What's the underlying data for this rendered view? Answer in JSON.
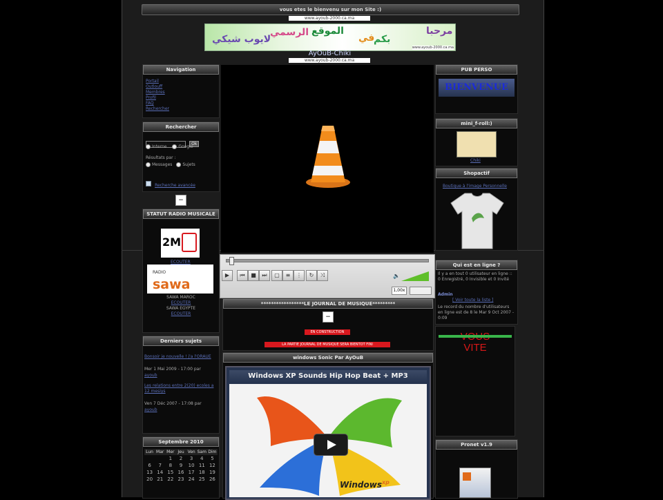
{
  "header": {
    "welcome": "vous etes le bienvenu sur mon Site :)",
    "url_top": "www.ayoub-2000.ca.ma",
    "site_name": "AyOuB-Chiki",
    "url_mid": "www.ayoub-2000.ca.ma"
  },
  "banner": {
    "words": [
      "مرحبا",
      "بكم",
      "في",
      "الموقع",
      "الرسمي",
      "لايوب شيكي"
    ],
    "url": "www.ayoub-2000.ca.ma"
  },
  "left": {
    "navigation": {
      "title": "Navigation",
      "links": [
        "Portail",
        "Outlouff",
        "Membres",
        "Profil",
        "FAQ",
        "Rechercher"
      ]
    },
    "search": {
      "title": "Rechercher",
      "input_value": "",
      "button": "Ok",
      "option_internal": "Interne",
      "option_google": "Google",
      "filter_label": "Résultats par :",
      "option_messages": "Messages",
      "option_subjects": "Sujets",
      "advanced_link": "Recherche avancée"
    },
    "radio": {
      "title": "STATUT RADIO MUSICALE",
      "listen_1": "ECOUTER",
      "sawa_maroc": "SAWA MAROC",
      "listen_2": "ECOUTER",
      "sawa_egypt": "SAWA EGYPTE",
      "listen_3": "ECOUTER"
    },
    "recent_topics": {
      "title": "Derniers sujets",
      "items": [
        {
          "title": "Bonsoir je nouvelle ! j'a l'ORAUE",
          "meta": "Mer 1 Mai 2009 - 17:00 par",
          "author": "ayoub"
        },
        {
          "title": "Les relations entre 2(20) ecoles a 12 mesiys",
          "meta": "Ven 7 Déc 2007 - 17:08 par",
          "author": "ayoub"
        }
      ]
    },
    "calendar": {
      "title": "Septembre 2010",
      "days": [
        "Lun",
        "Mar",
        "Mer",
        "Jeu",
        "Ven",
        "Sam",
        "Dim"
      ],
      "weeks": [
        [
          "",
          "",
          "1",
          "2",
          "3",
          "4",
          "5"
        ],
        [
          "6",
          "7",
          "8",
          "9",
          "10",
          "11",
          "12"
        ],
        [
          "13",
          "14",
          "15",
          "16",
          "17",
          "18",
          "19"
        ],
        [
          "20",
          "21",
          "22",
          "23",
          "24",
          "25",
          "26"
        ]
      ]
    }
  },
  "center": {
    "player_time": "1,00x",
    "journal": {
      "title": "*****************LE JOURNAL DE MUSIQUE*********",
      "status": "EN CONSTRUCTION",
      "notice": "LA PARTIE JOURNAL DE MUSIQUE SERA BIENTOT FINI"
    },
    "videos": {
      "title": "windows Sonic Par AyOuB",
      "video_title": "Windows XP Sounds Hip Hop Beat + MP3 Download Link",
      "windows_word": "Windows",
      "xp_word": "xp"
    }
  },
  "right": {
    "pub": {
      "title": "PUB PERSO",
      "banner_text": "BIENVENUE"
    },
    "mini": {
      "title": "mini_f-roll:)",
      "link": "Chiki"
    },
    "shop": {
      "title": "Shopactif",
      "link": "Boutique à l'image Personnelle"
    },
    "online": {
      "title": "Qui est en ligne ?",
      "text": "Il y a en tout 0 utilisateur en ligne :: 0 Enregistré, 0 Invisible et 0 Invité",
      "admin_label": "Admin",
      "admin_link": "[ Voir toute la liste ]",
      "record": "Le record du nombre d'utilisateurs en ligne est de 8 le Mar 9 Oct 2007 - 0:09"
    },
    "ad": {
      "line1": "VOUS",
      "line2": "VITE"
    },
    "app": {
      "title": "Pronet v1.9"
    }
  },
  "colors": {
    "page_bg": "#000000",
    "panel_head": "#4a4a4a",
    "link": "#5b6fb8",
    "vlc_orange": "#f28c1c",
    "warning_red": "#d8181e"
  },
  "icons": [
    "vlc-cone-icon",
    "play-icon",
    "stop-icon",
    "search-icon",
    "close-icon"
  ]
}
